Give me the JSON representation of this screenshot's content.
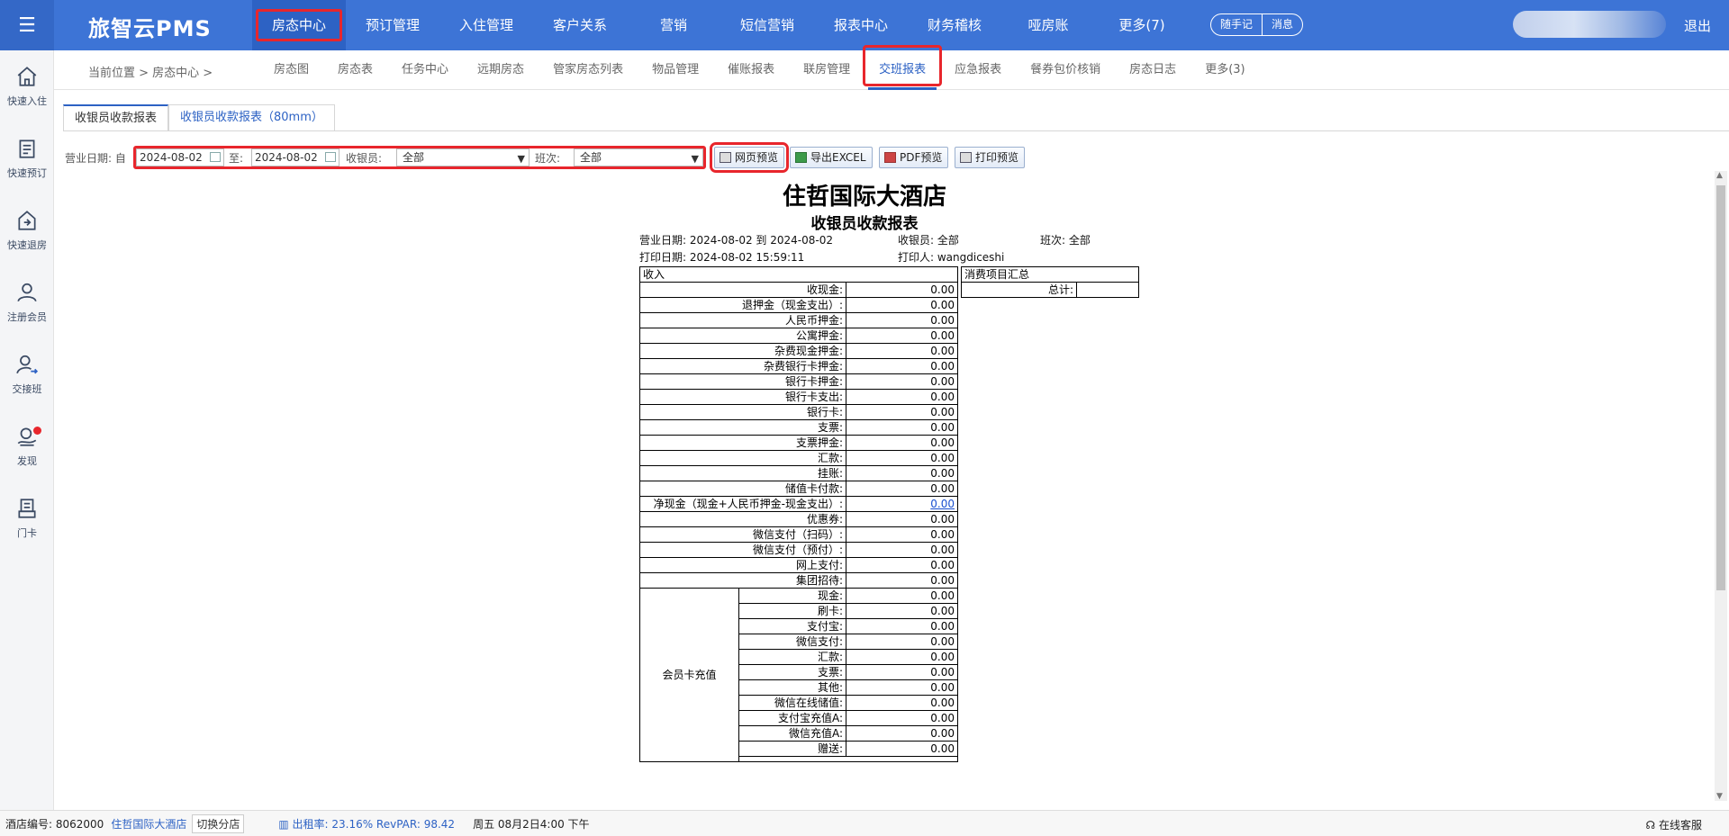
{
  "app": {
    "logo": "旅智云PMS",
    "logout": "退出"
  },
  "topnav": [
    {
      "label": "房态中心"
    },
    {
      "label": "预订管理"
    },
    {
      "label": "入住管理"
    },
    {
      "label": "客户关系"
    },
    {
      "label": "营销"
    },
    {
      "label": "短信营销"
    },
    {
      "label": "报表中心"
    },
    {
      "label": "财务稽核"
    },
    {
      "label": "哑房账"
    },
    {
      "label": "更多(7)"
    }
  ],
  "top_pills": {
    "note": "随手记",
    "message": "消息"
  },
  "subnav": {
    "breadcrumb": "当前位置 > 房态中心 >",
    "tabs": [
      {
        "label": "房态图"
      },
      {
        "label": "房态表"
      },
      {
        "label": "任务中心"
      },
      {
        "label": "远期房态"
      },
      {
        "label": "管家房态列表"
      },
      {
        "label": "物品管理"
      },
      {
        "label": "催账报表"
      },
      {
        "label": "联房管理"
      },
      {
        "label": "交班报表"
      },
      {
        "label": "应急报表"
      },
      {
        "label": "餐券包价核销"
      },
      {
        "label": "房态日志"
      },
      {
        "label": "更多(3)"
      }
    ]
  },
  "sidebar": [
    {
      "label": "快速入住",
      "icon": "home-icon"
    },
    {
      "label": "快速预订",
      "icon": "clipboard-icon"
    },
    {
      "label": "快速退房",
      "icon": "checkout-icon"
    },
    {
      "label": "注册会员",
      "icon": "user-icon"
    },
    {
      "label": "交接班",
      "icon": "user-switch-icon"
    },
    {
      "label": "发现",
      "icon": "discover-icon"
    },
    {
      "label": "门卡",
      "icon": "card-icon"
    }
  ],
  "report_tabs": {
    "tab1": "收银员收款报表",
    "tab2": "收银员收款报表（80mm）"
  },
  "filter": {
    "date_label": "营业日期: 自",
    "date_from": "2024-08-02",
    "to_label": "至:",
    "date_to": "2024-08-02",
    "cashier_label": "收银员:",
    "cashier_value": "全部",
    "shift_label": "班次:",
    "shift_value": "全部"
  },
  "buttons": {
    "web_preview": "网页预览",
    "export_excel": "导出EXCEL",
    "pdf_preview": "PDF预览",
    "print_preview": "打印预览"
  },
  "report": {
    "hotel": "住哲国际大酒店",
    "title": "收银员收款报表",
    "biz_date": "营业日期: 2024-08-02 到 2024-08-02",
    "cashier": "收银员: 全部",
    "shift": "班次: 全部",
    "print_date": "打印日期: 2024-08-02 15:59:11",
    "printer": "打印人: wangdiceshi",
    "income_header": "收入",
    "income_rows": [
      {
        "k": "收现金:",
        "v": "0.00"
      },
      {
        "k": "退押金（现金支出）:",
        "v": "0.00"
      },
      {
        "k": "人民币押金:",
        "v": "0.00"
      },
      {
        "k": "公寓押金:",
        "v": "0.00"
      },
      {
        "k": "杂费现金押金:",
        "v": "0.00"
      },
      {
        "k": "杂费银行卡押金:",
        "v": "0.00"
      },
      {
        "k": "银行卡押金:",
        "v": "0.00"
      },
      {
        "k": "银行卡支出:",
        "v": "0.00"
      },
      {
        "k": "银行卡:",
        "v": "0.00"
      },
      {
        "k": "支票:",
        "v": "0.00"
      },
      {
        "k": "支票押金:",
        "v": "0.00"
      },
      {
        "k": "汇款:",
        "v": "0.00"
      },
      {
        "k": "挂账:",
        "v": "0.00"
      },
      {
        "k": "储值卡付款:",
        "v": "0.00"
      },
      {
        "k": "净现金（现金+人民币押金-现金支出）:",
        "v": "0.00"
      },
      {
        "k": "优惠券:",
        "v": "0.00"
      },
      {
        "k": "微信支付（扫码）:",
        "v": "0.00"
      },
      {
        "k": "微信支付（预付）:",
        "v": "0.00"
      },
      {
        "k": "网上支付:",
        "v": "0.00"
      },
      {
        "k": "集团招待:",
        "v": "0.00"
      }
    ],
    "member_label": "会员卡充值",
    "member_rows": [
      {
        "k": "现金:",
        "v": "0.00"
      },
      {
        "k": "刷卡:",
        "v": "0.00"
      },
      {
        "k": "支付宝:",
        "v": "0.00"
      },
      {
        "k": "微信支付:",
        "v": "0.00"
      },
      {
        "k": "汇款:",
        "v": "0.00"
      },
      {
        "k": "支票:",
        "v": "0.00"
      },
      {
        "k": "其他:",
        "v": "0.00"
      },
      {
        "k": "微信在线储值:",
        "v": "0.00"
      },
      {
        "k": "支付宝充值A:",
        "v": "0.00"
      },
      {
        "k": "微信充值A:",
        "v": "0.00"
      },
      {
        "k": "赠送:",
        "v": "0.00"
      }
    ],
    "summary_header": "消费项目汇总",
    "summary_total_label": "总计:",
    "summary_total_value": ""
  },
  "status": {
    "hotel_no": "酒店编号: 8062000",
    "hotel_name": "住哲国际大酒店",
    "switch": "切换分店",
    "occupancy": "出租率: 23.16% RevPAR: 98.42",
    "datetime": "周五 08月2日4:00 下午",
    "service": "在线客服"
  }
}
